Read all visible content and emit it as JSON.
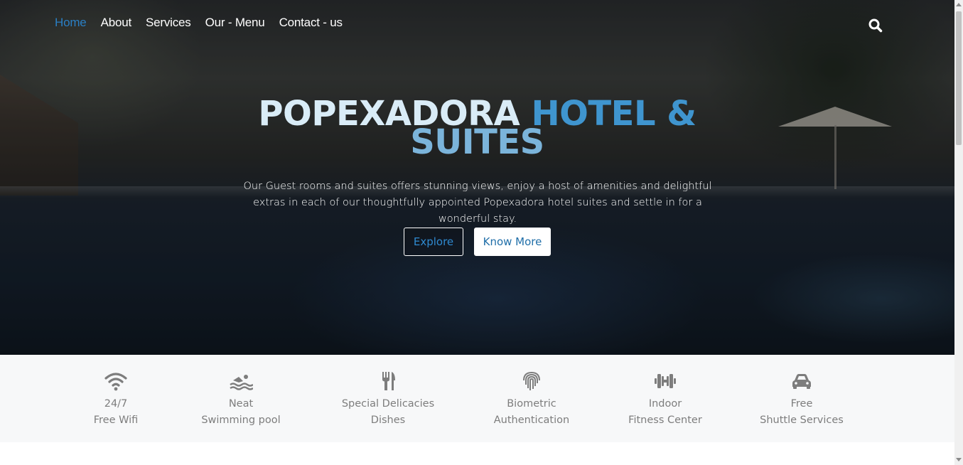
{
  "nav": {
    "items": [
      {
        "label": "Home",
        "active": true
      },
      {
        "label": "About"
      },
      {
        "label": "Services"
      },
      {
        "label": "Our - Menu"
      },
      {
        "label": "Contact - us"
      }
    ],
    "search_icon": "search-icon"
  },
  "hero": {
    "title_part1": "POPEXADORA",
    "title_part2": "HOTEL &",
    "title_line2": "SUITES",
    "subtitle": "Our Guest rooms and suites offers stunning views, enjoy a host of amenities and delightful extras in each of our thoughtfully appointed Popexadora hotel suites and settle in for a wonderful stay.",
    "explore_label": "Explore",
    "know_more_label": "Know More"
  },
  "features": [
    {
      "icon": "wifi-icon",
      "line1": "24/7",
      "line2": "Free Wifi"
    },
    {
      "icon": "swimmer-icon",
      "line1": "Neat",
      "line2": "Swimming pool"
    },
    {
      "icon": "utensils-icon",
      "line1": "Special Delicacies",
      "line2": "Dishes"
    },
    {
      "icon": "fingerprint-icon",
      "line1": "Biometric",
      "line2": "Authentication"
    },
    {
      "icon": "dumbbell-icon",
      "line1": "Indoor",
      "line2": "Fitness Center"
    },
    {
      "icon": "car-icon",
      "line1": "Free",
      "line2": "Shuttle Services"
    }
  ],
  "colors": {
    "accent": "#2a7fc4",
    "icon_gray": "#7d7d7d",
    "feature_bg": "#f7f8f9"
  }
}
